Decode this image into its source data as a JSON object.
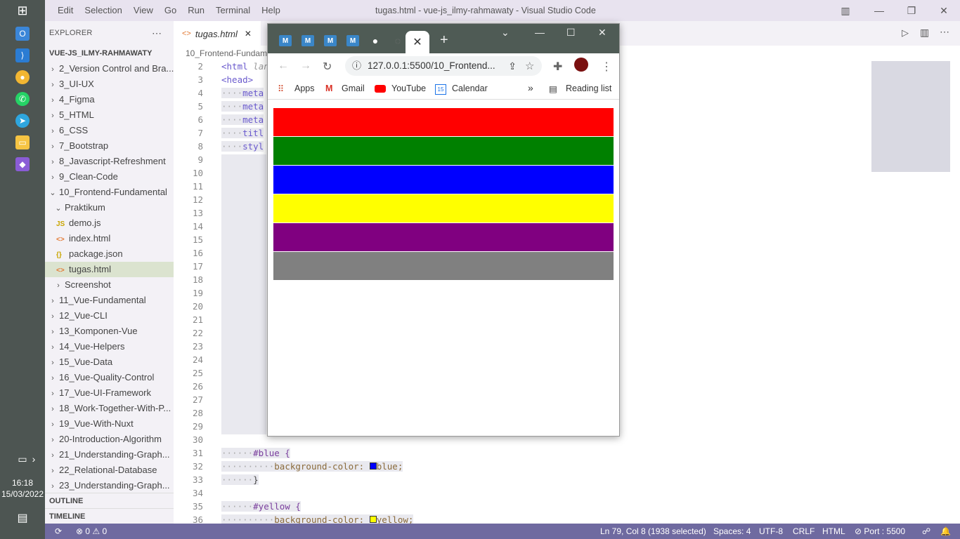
{
  "taskbar": {
    "time": "16:18",
    "date": "15/03/2022"
  },
  "titlebar": {
    "menus": [
      "Edit",
      "Selection",
      "View",
      "Go",
      "Run",
      "Terminal",
      "Help"
    ],
    "window_title": "tugas.html - vue-js_ilmy-rahmawaty - Visual Studio Code"
  },
  "sidebar": {
    "header": "EXPLORER",
    "project": "VUE-JS_ILMY-RAHMAWATY",
    "items": [
      {
        "label": "2_Version Control and Bra...",
        "kind": "folder"
      },
      {
        "label": "3_UI-UX",
        "kind": "folder"
      },
      {
        "label": "4_Figma",
        "kind": "folder"
      },
      {
        "label": "5_HTML",
        "kind": "folder"
      },
      {
        "label": "6_CSS",
        "kind": "folder"
      },
      {
        "label": "7_Bootstrap",
        "kind": "folder"
      },
      {
        "label": "8_Javascript-Refreshment",
        "kind": "folder"
      },
      {
        "label": "9_Clean-Code",
        "kind": "folder"
      },
      {
        "label": "10_Frontend-Fundamental",
        "kind": "folder-open"
      },
      {
        "label": "Praktikum",
        "kind": "folder-open-sub"
      },
      {
        "label": "demo.js",
        "kind": "js"
      },
      {
        "label": "index.html",
        "kind": "html"
      },
      {
        "label": "package.json",
        "kind": "json"
      },
      {
        "label": "tugas.html",
        "kind": "html-selected"
      },
      {
        "label": "Screenshot",
        "kind": "folder-sub"
      },
      {
        "label": "11_Vue-Fundamental",
        "kind": "folder"
      },
      {
        "label": "12_Vue-CLI",
        "kind": "folder"
      },
      {
        "label": "13_Komponen-Vue",
        "kind": "folder"
      },
      {
        "label": "14_Vue-Helpers",
        "kind": "folder"
      },
      {
        "label": "15_Vue-Data",
        "kind": "folder"
      },
      {
        "label": "16_Vue-Quality-Control",
        "kind": "folder"
      },
      {
        "label": "17_Vue-UI-Framework",
        "kind": "folder"
      },
      {
        "label": "18_Work-Together-With-P...",
        "kind": "folder"
      },
      {
        "label": "19_Vue-With-Nuxt",
        "kind": "folder"
      },
      {
        "label": "20-Introduction-Algorithm",
        "kind": "folder"
      },
      {
        "label": "21_Understanding-Graph...",
        "kind": "folder"
      },
      {
        "label": "22_Relational-Database",
        "kind": "folder"
      },
      {
        "label": "23_Understanding-Graph...",
        "kind": "folder"
      }
    ],
    "outline": "OUTLINE",
    "timeline": "TIMELINE"
  },
  "editor": {
    "tab_label": "tugas.html",
    "breadcrumb": "10_Frontend-Fundam",
    "line_numbers": [
      "2",
      "3",
      "4",
      "5",
      "6",
      "7",
      "8",
      "9",
      "10",
      "11",
      "12",
      "13",
      "14",
      "15",
      "16",
      "17",
      "18",
      "19",
      "20",
      "21",
      "22",
      "23",
      "24",
      "25",
      "26",
      "27",
      "28",
      "29",
      "30",
      "31",
      "32",
      "33",
      "34",
      "35",
      "36"
    ],
    "visible_code": {
      "l2": "<html",
      "l2b": "lan",
      "l3": "<head>",
      "l4": "meta",
      "l5": "meta",
      "l6": "meta",
      "l7": "titl",
      "l8": "styl",
      "l31": "#blue {",
      "l32": "background-color:",
      "l32v": "blue;",
      "l33": "}",
      "l35": "#yellow {",
      "l36": "background-color:",
      "l36v": "yellow;"
    }
  },
  "statusbar": {
    "errors": "0",
    "warnings": "0",
    "position": "Ln 79, Col 8 (1938 selected)",
    "spaces": "Spaces: 4",
    "encoding": "UTF-8",
    "eol": "CRLF",
    "language": "HTML",
    "port": "Port : 5500"
  },
  "browser": {
    "tab_icons": [
      "M",
      "M",
      "M",
      "M"
    ],
    "address": "127.0.0.1:5500/10_Frontend...",
    "bookmarks": [
      "Apps",
      "Gmail",
      "YouTube",
      "Calendar"
    ],
    "calendar_num": "15",
    "more": "»",
    "reading_list": "Reading list",
    "bands": [
      "#ff0000",
      "#008000",
      "#0000ff",
      "#ffff00",
      "#800080",
      "#808080"
    ]
  },
  "colors": {
    "statusbar": "#6f6aa0",
    "titlebar": "#e8e3ef",
    "taskbar": "#4d5552",
    "browser_frame": "#4f5b55"
  }
}
